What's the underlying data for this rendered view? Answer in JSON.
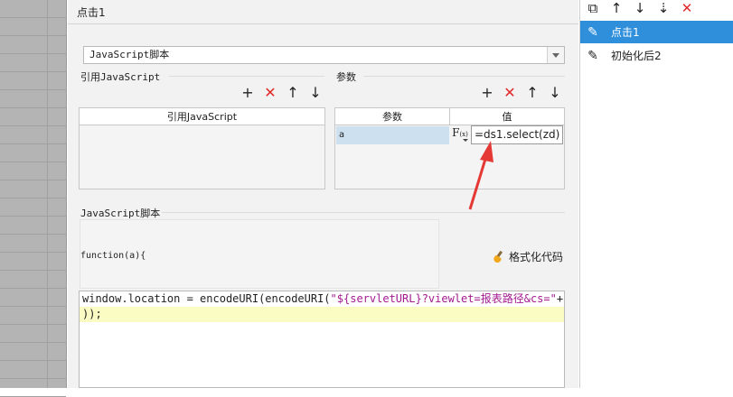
{
  "header": {
    "title": "点击1"
  },
  "script_type": {
    "selected": "JavaScript脚本"
  },
  "ref_js": {
    "title": "引用JavaScript",
    "column": "引用JavaScript",
    "toolbar": {
      "add": "+",
      "delete": "✕",
      "up": "↑",
      "down": "↓"
    }
  },
  "params": {
    "title": "参数",
    "col_name": "参数",
    "col_value": "值",
    "toolbar": {
      "add": "+",
      "delete": "✕",
      "up": "↑",
      "down": "↓"
    },
    "rows": [
      {
        "name": "a",
        "formula_icon": "F(x)",
        "value": "=ds1.select(zd)"
      }
    ]
  },
  "script": {
    "title": "JavaScript脚本",
    "signature": "function(a){",
    "format_label": "格式化代码",
    "code_line1_prefix": "window.location = encodeURI(encodeURI(",
    "code_line1_string": "\"${servletURL}?viewlet=报表路径&cs=\"",
    "code_line1_suffix": "+a",
    "code_line2": "));"
  },
  "events_panel": {
    "toolbar": {
      "copy": "⧉",
      "up": "↑",
      "down": "↓",
      "sort": "⇣",
      "delete": "✕"
    },
    "items": [
      {
        "label": "点击1",
        "selected": true
      },
      {
        "label": "初始化后2",
        "selected": false
      }
    ]
  },
  "colors": {
    "accent": "#2f8fdb",
    "delete": "#e02a2a",
    "arrow": "#e53935",
    "highlight": "#fbfbc4"
  }
}
